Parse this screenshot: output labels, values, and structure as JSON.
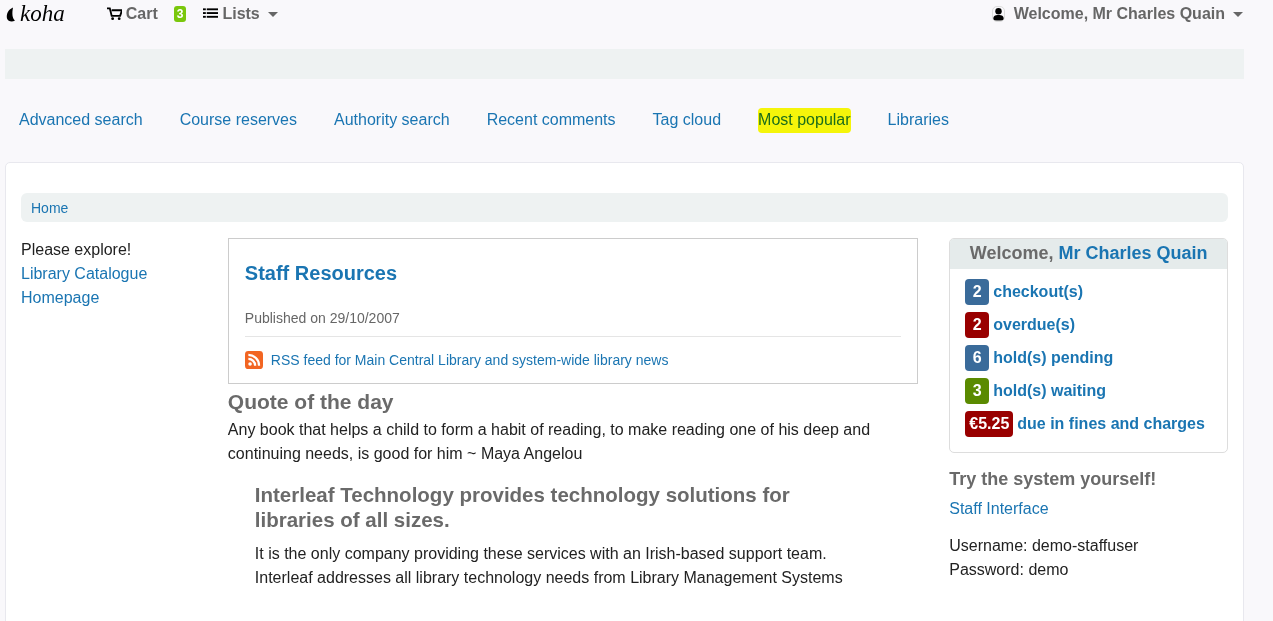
{
  "header": {
    "logo": "koha",
    "cart": {
      "label": "Cart",
      "count": "3"
    },
    "lists": {
      "label": "Lists"
    },
    "user": {
      "label": "Welcome, Mr Charles Quain"
    }
  },
  "nav": [
    {
      "label": "Advanced search",
      "highlighted": false
    },
    {
      "label": "Course reserves",
      "highlighted": false
    },
    {
      "label": "Authority search",
      "highlighted": false
    },
    {
      "label": "Recent comments",
      "highlighted": false
    },
    {
      "label": "Tag cloud",
      "highlighted": false
    },
    {
      "label": "Most popular",
      "highlighted": true
    },
    {
      "label": "Libraries",
      "highlighted": false
    }
  ],
  "breadcrumb": [
    "Home"
  ],
  "left": {
    "text": "Please explore!",
    "links": [
      "Library Catalogue",
      "Homepage"
    ]
  },
  "news": {
    "title": "Staff Resources",
    "published": "Published on 29/10/2007",
    "rss": "RSS feed for Main Central Library and system-wide library news"
  },
  "quote": {
    "heading": "Quote of the day",
    "text": "Any book that helps a child to form a habit of reading, to make reading one of his deep and continuing needs, is good for him ~ Maya Angelou"
  },
  "promo": {
    "heading": "Interleaf Technology provides technology solutions for libraries of all sizes.",
    "text": "It is the only company providing these services with an Irish-based support team. Interleaf addresses all library technology needs from Library Management Systems"
  },
  "summary": {
    "welcome": "Welcome,",
    "name": "Mr Charles Quain",
    "items": [
      {
        "count": "2",
        "label": "checkout(s)",
        "color": "#3a6b9a"
      },
      {
        "count": "2",
        "label": "overdue(s)",
        "color": "#990000"
      },
      {
        "count": "6",
        "label": "hold(s) pending",
        "color": "#3a6b9a"
      },
      {
        "count": "3",
        "label": "hold(s) waiting",
        "color": "#5a8a00"
      },
      {
        "count": "€5.25",
        "label": "due in fines and charges",
        "color": "#990000"
      }
    ]
  },
  "try": {
    "heading": "Try the system yourself!",
    "link": "Staff Interface",
    "lines": [
      "Username: demo-staffuser",
      "Password: demo"
    ]
  }
}
